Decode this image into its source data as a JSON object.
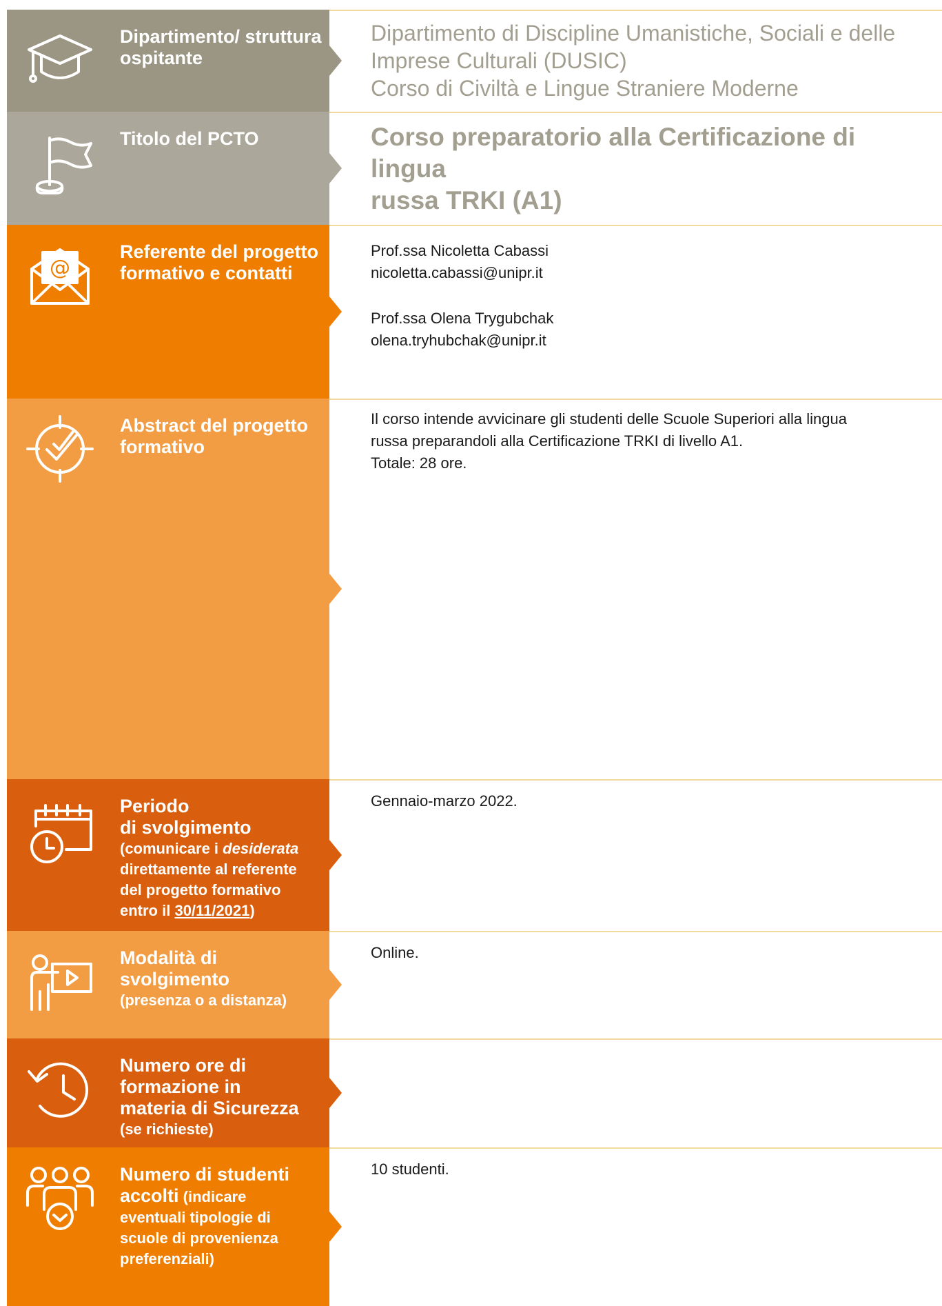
{
  "rows": [
    {
      "label": "Dipartimento/ struttura ospitante",
      "icon": "graduation-cap-icon",
      "content": {
        "line1": "Dipartimento di Discipline Umanistiche, Sociali e delle",
        "line2": "Imprese Culturali (DUSIC)",
        "line3": "Corso di Civiltà e Lingue Straniere Moderne"
      }
    },
    {
      "label": "Titolo del PCTO",
      "icon": "flag-icon",
      "content": {
        "title_line1": "Corso preparatorio alla Certificazione di lingua",
        "title_line2": "russa TRKI (A1)"
      }
    },
    {
      "label": "Referente del progetto formativo e contatti",
      "icon": "envelope-icon",
      "content": {
        "contact1_name": "Prof.ssa Nicoletta Cabassi",
        "contact1_email": "nicoletta.cabassi@unipr.it",
        "contact2_name": "Prof.ssa Olena Trygubchak",
        "contact2_email": "olena.tryhubchak@unipr.it"
      }
    },
    {
      "label": "Abstract del progetto formativo",
      "icon": "target-check-icon",
      "content": {
        "line1": "Il corso intende avvicinare gli studenti delle Scuole Superiori alla lingua",
        "line2": "russa preparandoli alla Certificazione TRKI di livello A1.",
        "line3": "Totale: 28 ore."
      }
    },
    {
      "label_line1": "Periodo",
      "label_line2": "di svolgimento",
      "sub_a": "(comunicare i ",
      "sub_italic": "desiderata",
      "sub_b": "direttamente al referente",
      "sub_c": "del progetto formativo",
      "sub_d": "entro il ",
      "sub_date": "30/11/2021",
      "sub_close": ")",
      "icon": "calendar-clock-icon",
      "content": {
        "line1": "Gennaio-marzo 2022."
      }
    },
    {
      "label_line1": "Modalità di",
      "label_line2": "svolgimento",
      "sub": "(presenza o a distanza)",
      "icon": "presentation-icon",
      "content": {
        "line1": "Online."
      }
    },
    {
      "label_line1": "Numero ore di",
      "label_line2": "formazione in",
      "label_line3": "materia di Sicurezza",
      "sub": "(se richieste)",
      "icon": "history-clock-icon",
      "content": {
        "line1": ""
      }
    },
    {
      "label_line1": "Numero di studenti",
      "label_line2": "accolti",
      "sub_inline": " (indicare",
      "sub_b": "eventuali tipologie di",
      "sub_c": "scuole di provenienza",
      "sub_d": "preferenziali)",
      "icon": "group-icon",
      "content": {
        "line1": "10 studenti."
      }
    }
  ],
  "colors": {
    "grey1": "#9b9684",
    "grey2": "#aba79a",
    "orange": "#ee7d00",
    "orange_light": "#f29d43",
    "orange_dark": "#d95f0e",
    "text_grey": "#a29e90"
  }
}
